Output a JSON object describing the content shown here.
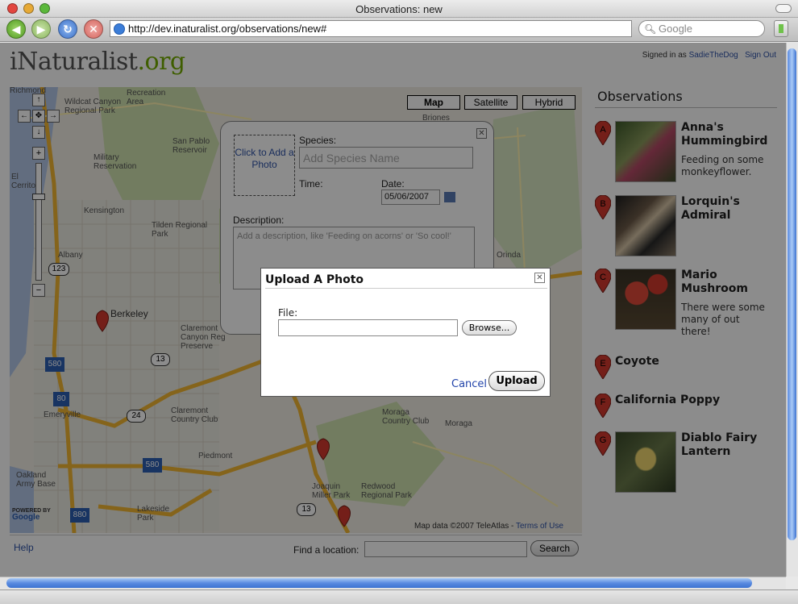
{
  "window": {
    "title": "Observations: new"
  },
  "browser": {
    "url": "http://dev.inaturalist.org/observations/new#",
    "search_placeholder": "Google"
  },
  "header": {
    "logo_main": "iNaturalist",
    "logo_suffix": ".org",
    "signed_in_prefix": "Signed in as",
    "username": "SadieTheDog",
    "sign_out": "Sign Out"
  },
  "map": {
    "types": [
      "Map",
      "Satellite",
      "Hybrid"
    ],
    "selected_type": "Map",
    "labels": [
      "Richmond",
      "Wildcat Canyon Regional Park",
      "Recreation Area",
      "San Pablo Reservoir",
      "Military Reservation",
      "El Cerrito",
      "Kensington",
      "Tilden Regional Park",
      "Albany",
      "Berkeley",
      "Claremont Canyon Reg Preserve",
      "Emeryville",
      "Claremont Country Club",
      "Piedmont",
      "Oakland Army Base",
      "Joaquin Miller Park",
      "Redwood Regional Park",
      "Moraga",
      "Moraga Country Club",
      "Lakeside Park",
      "Briones",
      "Orinda"
    ],
    "attribution": "Map data ©2007 TeleAtlas -",
    "terms": "Terms of Use",
    "highway_shields": [
      "123",
      "13",
      "580",
      "80",
      "24",
      "580",
      "880",
      "13",
      "24"
    ],
    "markers": [
      "A",
      "C"
    ]
  },
  "map_footer": {
    "help": "Help",
    "find_label": "Find a location:",
    "search_button": "Search"
  },
  "obs_form": {
    "add_photo": "Click to Add a Photo",
    "species_label": "Species:",
    "species_placeholder": "Add Species Name",
    "time_label": "Time:",
    "date_label": "Date:",
    "date_value": "05/06/2007",
    "description_label": "Description:",
    "description_placeholder": "Add a description, like 'Feeding on acorns' or 'So cool!'"
  },
  "modal": {
    "title": "Upload A Photo",
    "file_label": "File:",
    "browse": "Browse...",
    "cancel": "Cancel",
    "upload": "Upload"
  },
  "sidebar": {
    "title": "Observations",
    "items": [
      {
        "marker": "A",
        "name": "Anna's Hummingbird",
        "desc": "Feeding on some monkeyflower."
      },
      {
        "marker": "B",
        "name": "Lorquin's Admiral",
        "desc": ""
      },
      {
        "marker": "C",
        "name": "Mario Mushroom",
        "desc": "There were some many of out there!"
      },
      {
        "marker": "E",
        "name": "Coyote",
        "desc": ""
      },
      {
        "marker": "F",
        "name": "California Poppy",
        "desc": ""
      },
      {
        "marker": "G",
        "name": "Diablo Fairy Lantern",
        "desc": ""
      }
    ]
  },
  "colors": {
    "link": "#2f53a8",
    "logo_green": "#74ac00",
    "marker_red": "#d33a2f",
    "highway_yellow": "#f2b632"
  }
}
